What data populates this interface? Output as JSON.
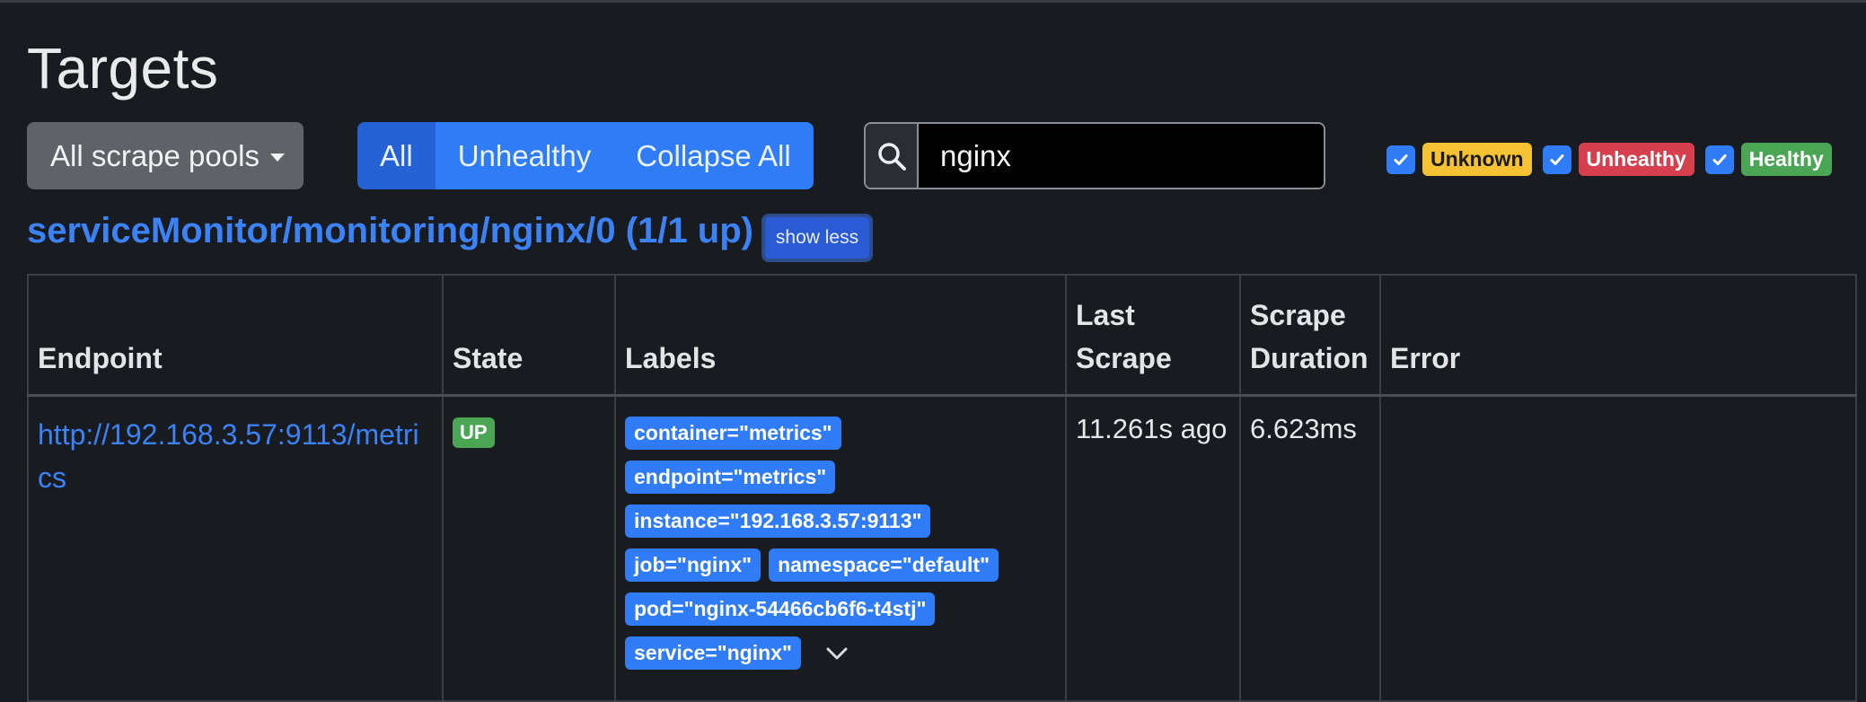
{
  "page": {
    "title": "Targets"
  },
  "toolbar": {
    "pool_dropdown_label": "All scrape pools",
    "filter_buttons": [
      {
        "label": "All",
        "active": true
      },
      {
        "label": "Unhealthy",
        "active": false
      },
      {
        "label": "Collapse All",
        "active": false
      }
    ],
    "search": {
      "value": "nginx",
      "icon": "search-icon"
    },
    "health_filters": [
      {
        "label": "Unknown",
        "checked": true,
        "color": "#f5c233"
      },
      {
        "label": "Unhealthy",
        "checked": true,
        "color": "#d6404e"
      },
      {
        "label": "Healthy",
        "checked": true,
        "color": "#4aa654"
      }
    ]
  },
  "pool": {
    "heading": "serviceMonitor/monitoring/nginx/0 (1/1 up)",
    "toggle_label": "show less",
    "table": {
      "headers": [
        "Endpoint",
        "State",
        "Labels",
        "Last Scrape",
        "Scrape Duration",
        "Error"
      ],
      "rows": [
        {
          "endpoint": "http://192.168.3.57:9113/metrics",
          "state": "UP",
          "labels": [
            "container=\"metrics\"",
            "endpoint=\"metrics\"",
            "instance=\"192.168.3.57:9113\"",
            "job=\"nginx\"",
            "namespace=\"default\"",
            "pod=\"nginx-54466cb6f6-t4stj\"",
            "service=\"nginx\""
          ],
          "last_scrape": "11.261s ago",
          "scrape_duration": "6.623ms",
          "error": ""
        }
      ]
    }
  },
  "colors": {
    "accent": "#2f7cf6",
    "link": "#3b82f6",
    "background": "#181b20",
    "up": "#4aa654"
  }
}
